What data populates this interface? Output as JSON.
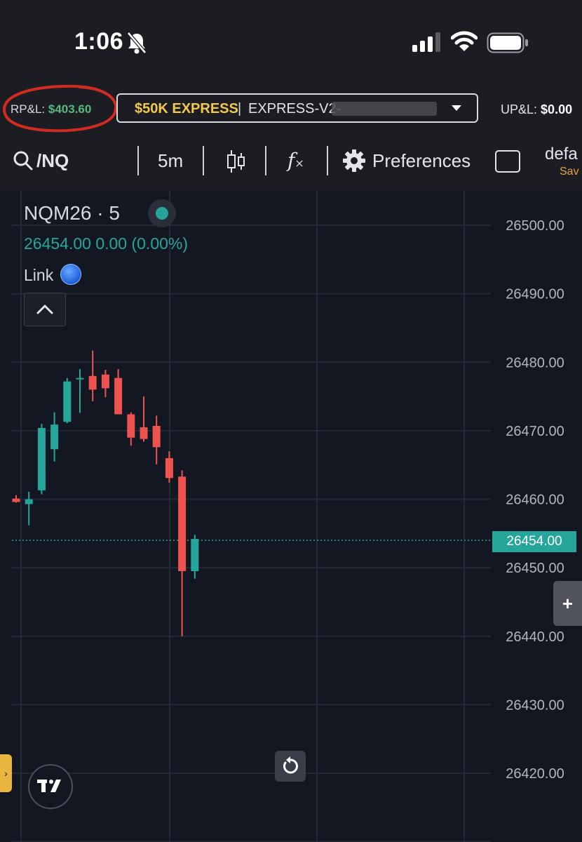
{
  "status_bar": {
    "time": "1:06"
  },
  "account": {
    "rpl_label": "RP&L:",
    "rpl_value": "$403.60",
    "name": "$50K EXPRESS",
    "separator": "|",
    "id": "EXPRESS-V2-",
    "upl_label": "UP&L:",
    "upl_value": "$0.00"
  },
  "toolbar": {
    "symbol": "/NQ",
    "interval": "5m",
    "fx_label": "f",
    "preferences": "Preferences",
    "layout_name": "defa",
    "save_label": "Sav"
  },
  "legend": {
    "symbol": "NQM26 · 5",
    "price_line": "26454.00  0.00 (0.00%)",
    "link_label": "Link"
  },
  "current_price_tag": "26454.00",
  "plus_button": "+",
  "side_tab_glyph": "›",
  "colors": {
    "up": "#26a69a",
    "down": "#ef5350",
    "rpl_value": "#56b87f",
    "account_name": "#f2c94c",
    "save": "#e6a23c"
  },
  "icons": [
    "bell-slash-icon",
    "signal-icon",
    "wifi-icon",
    "battery-icon",
    "search-icon",
    "candles-icon",
    "gear-icon",
    "chevron-up-icon",
    "reset-icon",
    "tradingview-logo-icon"
  ],
  "chart_data": {
    "type": "candlestick",
    "title": "NQM26 · 5",
    "ylim": [
      26415,
      26503
    ],
    "y_ticks": [
      "26500.00",
      "26490.00",
      "26480.00",
      "26470.00",
      "26460.00",
      "26450.00",
      "26440.00",
      "26430.00",
      "26420.00"
    ],
    "last_price": 26454.0,
    "candles": [
      {
        "open": 26460.1,
        "high": 26460.6,
        "low": 26459.5,
        "close": 26459.6
      },
      {
        "open": 26459.3,
        "high": 26461.1,
        "low": 26456.2,
        "close": 26460.0
      },
      {
        "open": 26461.3,
        "high": 26471.0,
        "low": 26460.7,
        "close": 26470.4
      },
      {
        "open": 26467.3,
        "high": 26472.7,
        "low": 26465.5,
        "close": 26470.9
      },
      {
        "open": 26471.3,
        "high": 26477.7,
        "low": 26471.1,
        "close": 26477.2
      },
      {
        "open": 26477.5,
        "high": 26479.0,
        "low": 26472.6,
        "close": 26477.7
      },
      {
        "open": 26478.0,
        "high": 26481.7,
        "low": 26474.3,
        "close": 26476.0
      },
      {
        "open": 26478.2,
        "high": 26478.9,
        "low": 26474.9,
        "close": 26476.2
      },
      {
        "open": 26477.7,
        "high": 26479.0,
        "low": 26473.3,
        "close": 26472.4
      },
      {
        "open": 26472.4,
        "high": 26472.7,
        "low": 26467.8,
        "close": 26469.0
      },
      {
        "open": 26470.5,
        "high": 26475.0,
        "low": 26468.4,
        "close": 26468.8
      },
      {
        "open": 26470.7,
        "high": 26472.2,
        "low": 26465.1,
        "close": 26467.6
      },
      {
        "open": 26466.0,
        "high": 26467.0,
        "low": 26462.4,
        "close": 26463.1
      },
      {
        "open": 26463.3,
        "high": 26464.2,
        "low": 26440.0,
        "close": 26449.5
      },
      {
        "open": 26449.5,
        "high": 26454.8,
        "low": 26448.4,
        "close": 26454.2
      }
    ]
  }
}
